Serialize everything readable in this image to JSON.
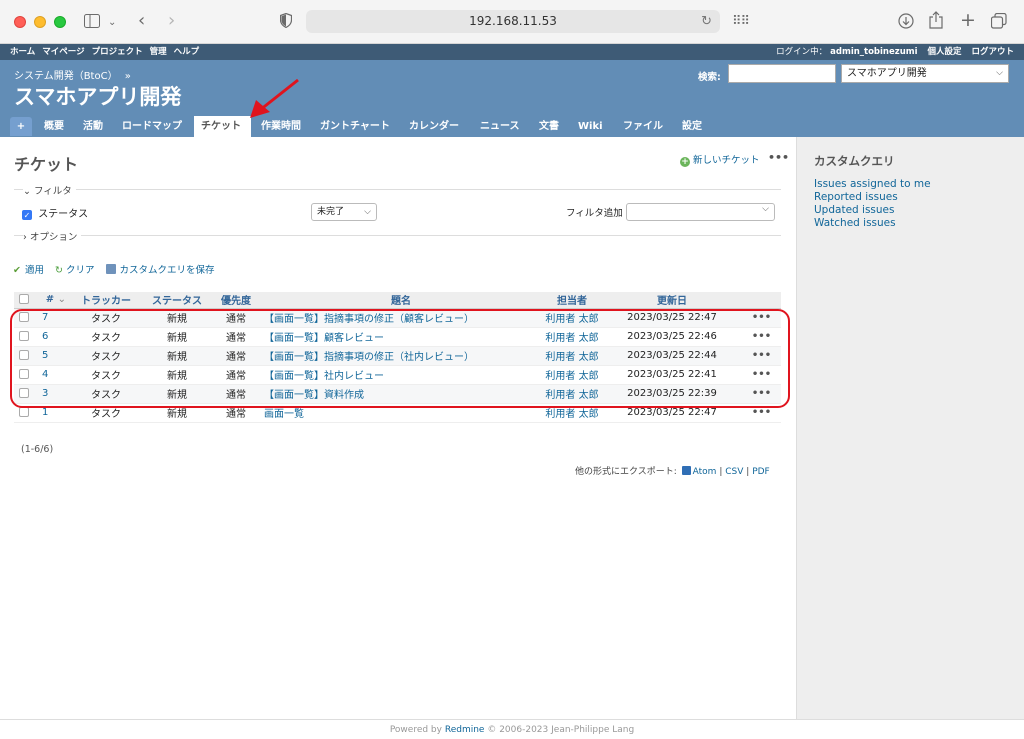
{
  "browser": {
    "url": "192.168.11.53"
  },
  "top_menu": {
    "items": [
      "ホーム",
      "マイページ",
      "プロジェクト",
      "管理",
      "ヘルプ"
    ],
    "login_label": "ログイン中：",
    "login_user": "admin_tobinezumi",
    "my_account": "個人設定",
    "logout": "ログアウト"
  },
  "header": {
    "parent_project": "システム開発（BtoC）",
    "parent_separator": "»",
    "project_title": "スマホアプリ開発",
    "search_label": "検索:",
    "search_value": "",
    "project_select": "スマホアプリ開発"
  },
  "tabs": [
    "+",
    "概要",
    "活動",
    "ロードマップ",
    "チケット",
    "作業時間",
    "ガントチャート",
    "カレンダー",
    "ニュース",
    "文書",
    "Wiki",
    "ファイル",
    "設定"
  ],
  "selected_tab": "チケット",
  "content": {
    "page_title": "チケット",
    "new_issue": "新しいチケット",
    "more": "•••",
    "filter_legend": "フィルタ",
    "status_filter_label": "ステータス",
    "status_operator": "未完了",
    "add_filter_label": "フィルタ追加",
    "options_legend": "オプション",
    "apply": "適用",
    "clear": "クリア",
    "save_query": "カスタムクエリを保存",
    "count": "(1-6/6)",
    "export_label": "他の形式にエクスポート:",
    "export_atom": "Atom",
    "export_csv": "CSV",
    "export_pdf": "PDF",
    "separator": "|"
  },
  "table": {
    "headers": {
      "id": "#",
      "tracker": "トラッカー",
      "status": "ステータス",
      "priority": "優先度",
      "subject": "題名",
      "assignee": "担当者",
      "updated": "更新日"
    },
    "rows": [
      {
        "id": "7",
        "tracker": "タスク",
        "status": "新規",
        "priority": "通常",
        "subject": "【画面一覧】指摘事項の修正（顧客レビュー）",
        "assignee": "利用者 太郎",
        "updated": "2023/03/25 22:47",
        "more": "•••"
      },
      {
        "id": "6",
        "tracker": "タスク",
        "status": "新規",
        "priority": "通常",
        "subject": "【画面一覧】顧客レビュー",
        "assignee": "利用者 太郎",
        "updated": "2023/03/25 22:46",
        "more": "•••"
      },
      {
        "id": "5",
        "tracker": "タスク",
        "status": "新規",
        "priority": "通常",
        "subject": "【画面一覧】指摘事項の修正（社内レビュー）",
        "assignee": "利用者 太郎",
        "updated": "2023/03/25 22:44",
        "more": "•••"
      },
      {
        "id": "4",
        "tracker": "タスク",
        "status": "新規",
        "priority": "通常",
        "subject": "【画面一覧】社内レビュー",
        "assignee": "利用者 太郎",
        "updated": "2023/03/25 22:41",
        "more": "•••"
      },
      {
        "id": "3",
        "tracker": "タスク",
        "status": "新規",
        "priority": "通常",
        "subject": "【画面一覧】資料作成",
        "assignee": "利用者 太郎",
        "updated": "2023/03/25 22:39",
        "more": "•••"
      },
      {
        "id": "1",
        "tracker": "タスク",
        "status": "新規",
        "priority": "通常",
        "subject": "画面一覧",
        "assignee": "利用者 太郎",
        "updated": "2023/03/25 22:47",
        "more": "•••"
      }
    ]
  },
  "sidebar": {
    "title": "カスタムクエリ",
    "queries": [
      "Issues assigned to me",
      "Reported issues",
      "Updated issues",
      "Watched issues"
    ]
  },
  "footer": {
    "prefix": "Powered by",
    "link": "Redmine",
    "suffix": "© 2006-2023 Jean-Philippe Lang"
  },
  "colors": {
    "header": "#628db6",
    "top_menu": "#3e5b76",
    "link": "#116699",
    "annotation": "#e0141e"
  }
}
